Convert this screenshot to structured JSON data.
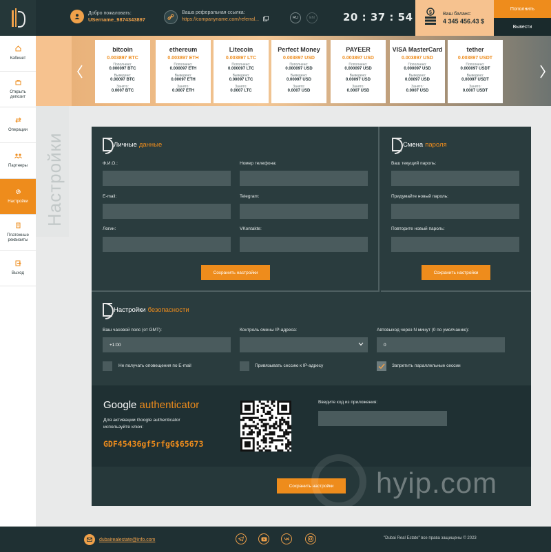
{
  "header": {
    "welcome_label": "Добро пожаловать:",
    "username": "USername_9874343897",
    "referral_label": "Ваша реферальная ссылка:",
    "referral_link": "https://companyname.com/referral...",
    "lang_ru": "RU",
    "lang_en": "EN",
    "clock": "20 : 37 : 54",
    "balance_label": "Ваш баланс:",
    "balance_amount": "4 345 456.43 $",
    "topup_label": "Пополнить",
    "withdraw_label": "Вывести"
  },
  "sidebar": {
    "items": [
      {
        "label": "Кабинет",
        "icon": "home-icon"
      },
      {
        "label": "Открыть депозит",
        "icon": "deposit-icon"
      },
      {
        "label": "Операции",
        "icon": "operations-icon"
      },
      {
        "label": "Партнеры",
        "icon": "partners-icon"
      },
      {
        "label": "Настройки",
        "icon": "settings-icon",
        "active": true
      },
      {
        "label": "Платежные реквизиты",
        "icon": "payment-icon"
      },
      {
        "label": "Выход",
        "icon": "logout-icon"
      }
    ]
  },
  "rates": {
    "replenished_label": "Пополнено:",
    "withdrawn_label": "Выведено:",
    "borrowed_label": "Занято:",
    "cards": [
      {
        "brand": "bitcoin",
        "rate": "0.003897 BTC",
        "replenished": "0.000097 BTC",
        "withdrawn": "0.00097 BTC",
        "borrowed": "0.0007 BTC"
      },
      {
        "brand": "ethereum",
        "rate": "0.003897 ETH",
        "replenished": "0.000097 ETH",
        "withdrawn": "0.00097 ETH",
        "borrowed": "0.0007 ETH"
      },
      {
        "brand": "Litecoin",
        "rate": "0.003897 LTC",
        "replenished": "0.000097 LTC",
        "withdrawn": "0.00097 LTC",
        "borrowed": "0.0007 LTC"
      },
      {
        "brand": "Perfect Money",
        "rate": "0.003897 USD",
        "replenished": "0.000097 USD",
        "withdrawn": "0.00097 USD",
        "borrowed": "0.0007 USD"
      },
      {
        "brand": "PAYEER",
        "rate": "0.003897 USD",
        "replenished": "0.000097 USD",
        "withdrawn": "0.00097 USD",
        "borrowed": "0.0007 USD"
      },
      {
        "brand": "VISA MasterCard",
        "rate": "0.003897 USD",
        "replenished": "0.000097 USD",
        "withdrawn": "0.00097 USD",
        "borrowed": "0.0007 USD"
      },
      {
        "brand": "tether",
        "rate": "0.003897 USDT",
        "replenished": "0.000097 USDT",
        "withdrawn": "0.00097 USDT",
        "borrowed": "0.0007 USDT"
      }
    ]
  },
  "page_title": "Настройки",
  "personal": {
    "title": "Личные",
    "title_accent": "данные",
    "fio_label": "Ф.И.О.:",
    "phone_label": "Номер телефона:",
    "email_label": "E-mail:",
    "telegram_label": "Telegram:",
    "login_label": "Логин:",
    "vk_label": "VKontakte:",
    "save_label": "Сохранить настройки"
  },
  "password": {
    "title": "Смена",
    "title_accent": "пароля",
    "current_label": "Ваш текущий пароль:",
    "new_label": "Придумайте новый пароль:",
    "repeat_label": "Повторите новый пароль:",
    "save_label": "Сохранить настройки"
  },
  "security": {
    "title": "Настройки",
    "title_accent": "безопасности",
    "timezone_label": "Ваш часовой пояс (от GMT):",
    "timezone_value": "+1:00",
    "ip_label": "Контроль смены IP-адреса:",
    "ip_value": "",
    "autologout_label": "Автовыход через N минут (0 по умолчанию):",
    "autologout_value": "0",
    "chk_email_label": "Не получать оповещения по E-mail",
    "chk_ip_label": "Привязывать сессию к IP-адресу",
    "chk_parallel_label": "Запретить параллельные сессии",
    "chk_email": false,
    "chk_ip": false,
    "chk_parallel": true
  },
  "google": {
    "title": "Google",
    "title_accent": "authenticator",
    "desc_line1": "Для активации Google authenticator",
    "desc_line2": "используйте ключ:",
    "key": "GDF45436gf5rfgG$65673",
    "code_label": "Введите код из приложения:",
    "code_value": ""
  },
  "save_bottom_label": "Сохранить настройки",
  "watermark": "hyip.com",
  "footer": {
    "email": "dubairealestate@info.com",
    "copyright": "\"Dubai Real Estate\" все права защищены © 2023"
  },
  "colors": {
    "accent": "#ee8c1c",
    "dark": "#1f3033",
    "panel": "#2a3c3e"
  }
}
